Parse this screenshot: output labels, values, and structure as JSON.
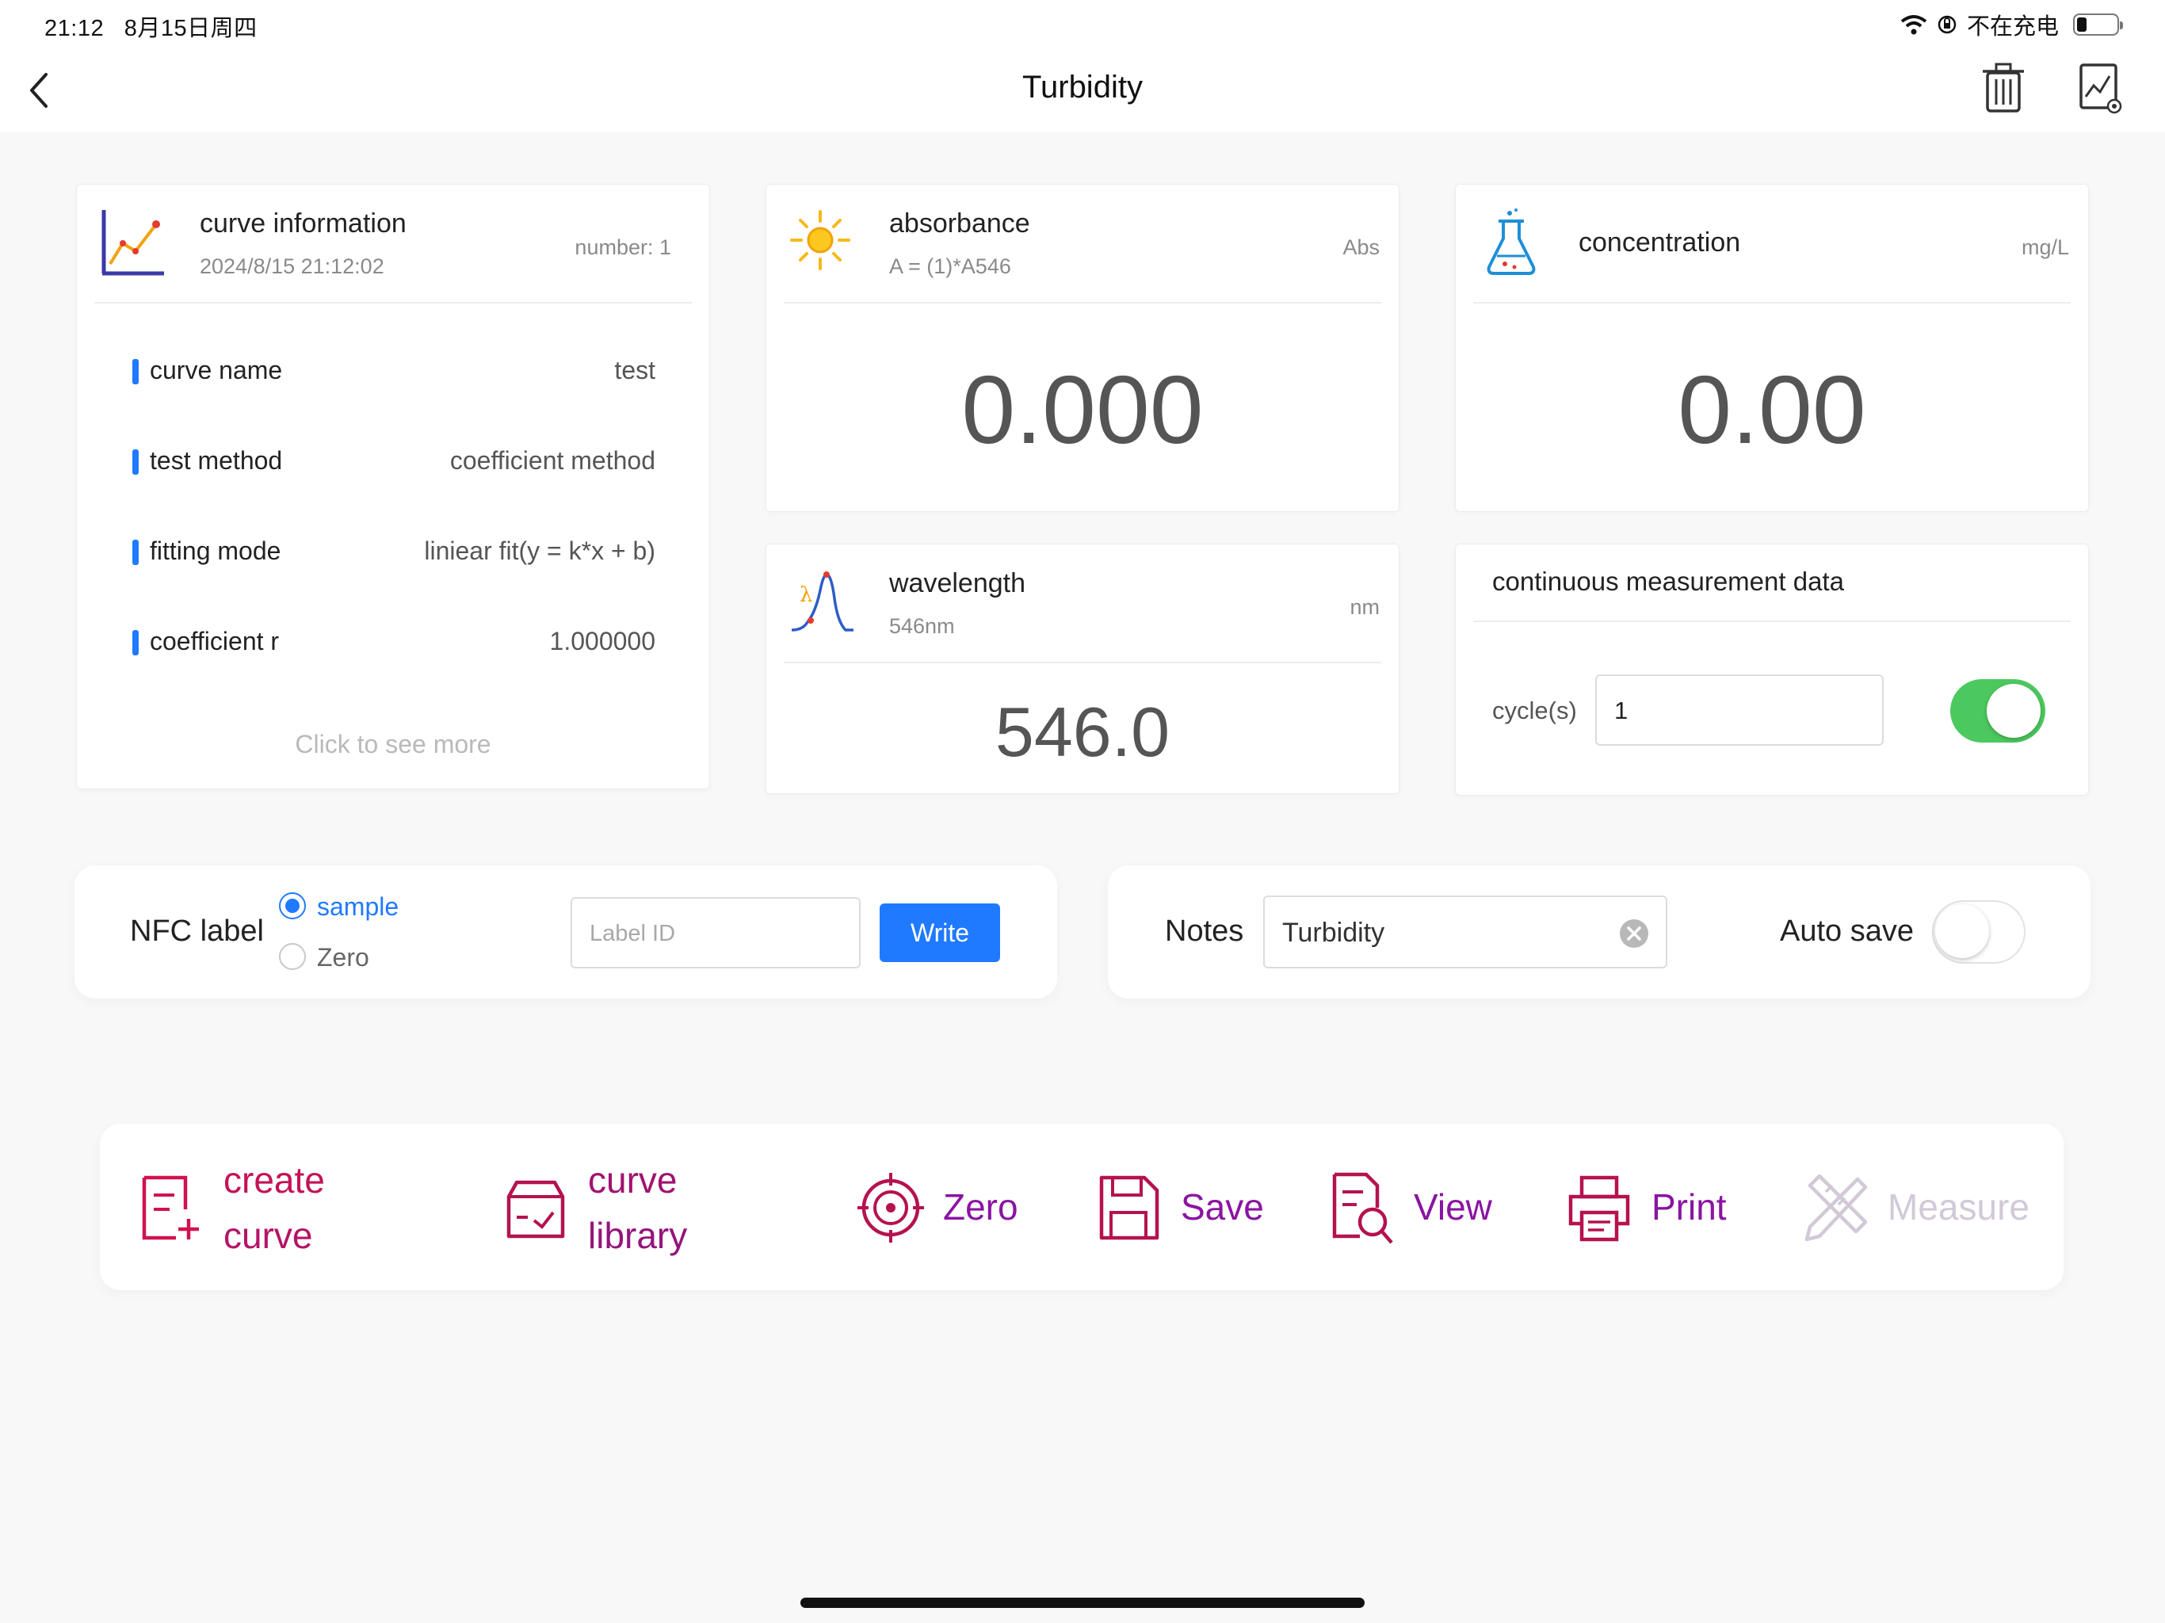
{
  "status_bar": {
    "time": "21:12",
    "date": "8月15日周四",
    "charging_text": "不在充电"
  },
  "header": {
    "title": "Turbidity",
    "icons": [
      "back-arrow-icon",
      "trash-icon",
      "chart-preview-icon"
    ]
  },
  "curve_info": {
    "title": "curve information",
    "datetime": "2024/8/15 21:12:02",
    "number_label": "number: 1",
    "rows": [
      {
        "label": "curve name",
        "value": "test"
      },
      {
        "label": "test method",
        "value": "coefficient method"
      },
      {
        "label": "fitting mode",
        "value": "liniear fit(y = k*x + b)"
      },
      {
        "label": "coefficient r",
        "value": "1.000000"
      }
    ],
    "see_more": "Click to see more"
  },
  "absorbance": {
    "title": "absorbance",
    "formula": "A = (1)*A546",
    "unit": "Abs",
    "value": "0.000"
  },
  "concentration": {
    "title": "concentration",
    "unit": "mg/L",
    "value": "0.00"
  },
  "wavelength": {
    "title": "wavelength",
    "sub": "546nm",
    "unit": "nm",
    "value": "546.0"
  },
  "continuous": {
    "title": "continuous measurement data",
    "cycles_label": "cycle(s)",
    "cycles_value": "1",
    "enabled": true
  },
  "nfc": {
    "label": "NFC label",
    "options": [
      "sample",
      "Zero"
    ],
    "selected": "sample",
    "input_placeholder": "Label ID",
    "write_button": "Write"
  },
  "notes": {
    "label": "Notes",
    "value": "Turbidity",
    "autosave_label": "Auto save",
    "autosave_on": false
  },
  "actions": {
    "create_curve_line1": "create",
    "create_curve_line2": "curve",
    "curve_library_line1": "curve",
    "curve_library_line2": "library",
    "zero": "Zero",
    "save": "Save",
    "view": "View",
    "print": "Print",
    "measure": "Measure"
  },
  "colors": {
    "accent_blue": "#1f7aff",
    "toggle_green": "#4cc95e",
    "action_gradient_start": "#d1124f",
    "action_gradient_end": "#7a15c0",
    "disabled_action": "#d2c9d8"
  }
}
